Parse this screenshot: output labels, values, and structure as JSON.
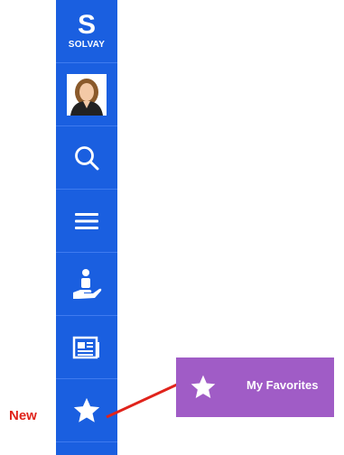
{
  "sidebar": {
    "logo": {
      "letter": "S",
      "word": "SOLVAY"
    },
    "items": [
      {
        "icon": "avatar"
      },
      {
        "icon": "search-icon"
      },
      {
        "icon": "menu-icon"
      },
      {
        "icon": "hand-person-icon"
      },
      {
        "icon": "news-icon"
      },
      {
        "icon": "star-icon"
      }
    ]
  },
  "favorites_panel": {
    "label": "My Favorites"
  },
  "callout": {
    "new_label": "New"
  },
  "colors": {
    "sidebar": "#1a5fe0",
    "panel": "#a05cc6",
    "callout": "#e0231b"
  }
}
